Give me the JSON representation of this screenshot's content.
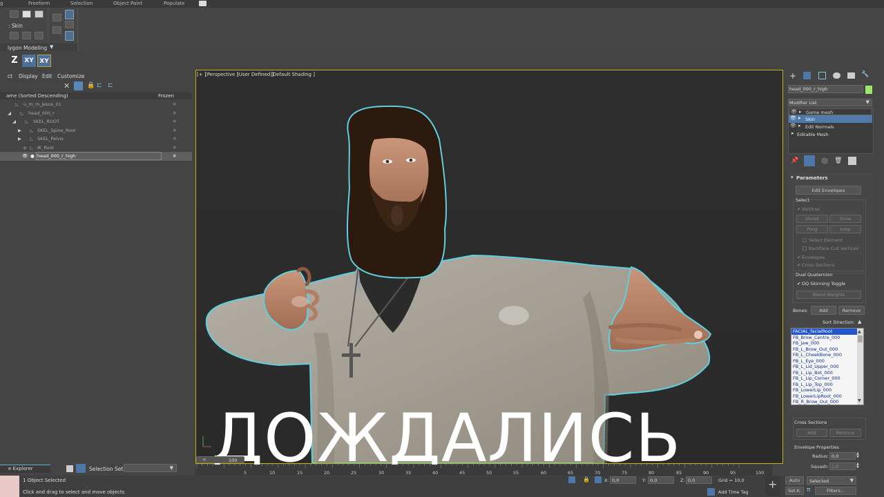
{
  "ribbon": {
    "tabs": [
      "g",
      "Freeform",
      "Selection",
      "Object Paint",
      "Populate"
    ],
    "skin_label": ": Skin",
    "polygon_modeling": "lygon Modeling"
  },
  "axis_buttons": [
    "Z",
    "XY",
    "XY"
  ],
  "explorer": {
    "menu": [
      "ct",
      "Display",
      "Edit",
      "Customize"
    ],
    "col_name": "ame (Sorted Descending)",
    "col_frozen": "Frozen",
    "rows": [
      "u_m_m_jesus_01",
      "head_000_r",
      "SKEL_ROOT",
      "SKEL_Spine_Root",
      "SKEL_Pelvis",
      "IK_Root",
      "head_000_r_high"
    ],
    "footer_label": "e Explorer",
    "selection_set_label": "Selection Set:"
  },
  "viewport": {
    "label_plus": "[+ ]",
    "label_view": "[Perspective ]",
    "label_user": "[User Defined ]",
    "label_shading": "[Default Shading ]"
  },
  "command_panel": {
    "object_name": "head_000_r_high",
    "modifier_list": "Modifier List",
    "stack": [
      "Game mesh",
      "Skin",
      "Edit Normals",
      "Editable Mesh"
    ],
    "parameters": "Parameters",
    "edit_envelopes": "Edit Envelopes",
    "select": "Select",
    "vertices": "Vertices",
    "shrink": "Shrink",
    "grow": "Grow",
    "ring": "Ring",
    "loop": "Loop",
    "select_element": "Select Element",
    "backface": "Backface Cull Vertices",
    "envelopes": "Envelopes",
    "cross_sections": "Cross Sections",
    "dual_quaternion": "Dual Quaternion",
    "dq_toggle": "DQ Skinning Toggle",
    "blend_weights": "Blend Weights",
    "bones": "Bones:",
    "add": "Add",
    "remove": "Remove",
    "sort_direction": "Sort Direction:",
    "bone_list": [
      "FACIAL_facialRoot",
      "FB_Brow_Centre_000",
      "FB_Jaw_000",
      "FB_L_Brow_Out_000",
      "FB_L_CheekBone_000",
      "FB_L_Eye_000",
      "FB_L_Lid_Upper_000",
      "FB_L_Lip_Bot_000",
      "FB_L_Lip_Corner_000",
      "FB_L_Lip_Top_000",
      "FB_LowerLip_000",
      "FB_LowerLipRoot_000",
      "FB_R_Brow_Out_000"
    ],
    "cross_sections_group": "Cross Sections",
    "cs_add": "Add",
    "cs_remove": "Remove",
    "envelope_properties": "Envelope Properties",
    "radius_label": "Radius:",
    "radius_value": "0,0",
    "squash_label": "Squash:",
    "squash_value": "1,0"
  },
  "timeline": {
    "frame_field": "100",
    "ticks": [
      "5",
      "10",
      "15",
      "20",
      "25",
      "30",
      "35",
      "40",
      "45",
      "50",
      "55",
      "60",
      "65",
      "70",
      "75",
      "80",
      "85",
      "90",
      "95",
      "100"
    ]
  },
  "status": {
    "objects_selected": "1 Object Selected",
    "hint": "Click and drag to select and move objects",
    "x_label": "X:",
    "x_value": "0,0",
    "y_label": "Y:",
    "y_value": "0,0",
    "z_label": "Z:",
    "z_value": "0,0",
    "grid": "Grid = 10,0",
    "add_time_tag": "Add Time Tag",
    "auto": "Auto",
    "set_k": "Set K.",
    "selected": "Selected",
    "filters": "Filters..."
  },
  "caption": "ДОЖДАЛИСЬ",
  "colors": {
    "selection_blue": "#2255cc",
    "viewport_border": "#c8b400",
    "outline_cyan": "#5fd0e0"
  }
}
